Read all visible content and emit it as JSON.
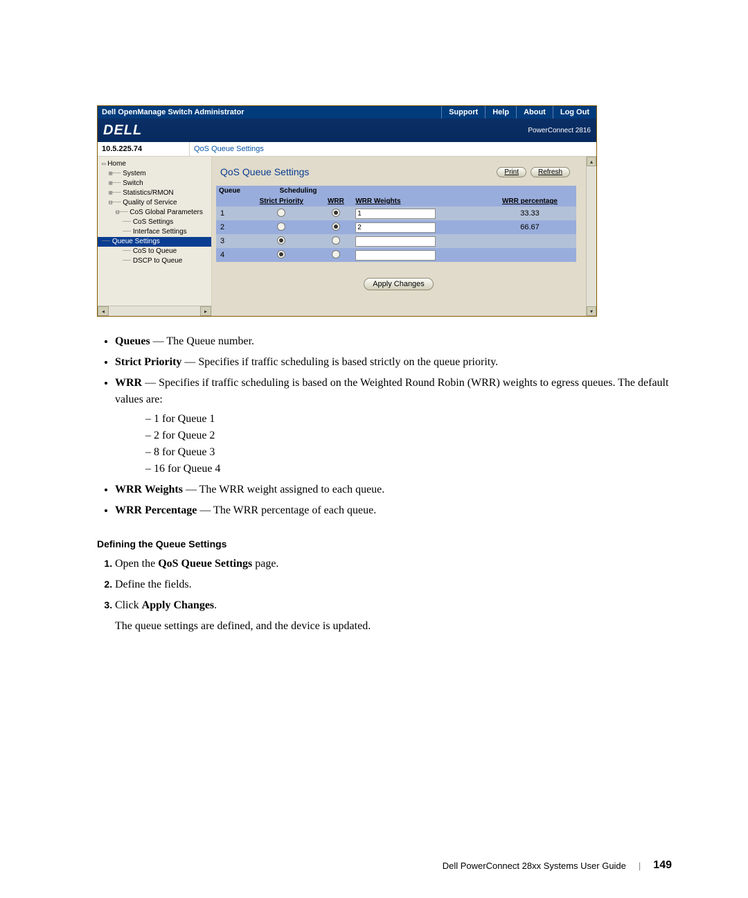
{
  "app": {
    "title": "Dell OpenManage Switch Administrator",
    "menu": {
      "support": "Support",
      "help": "Help",
      "about": "About",
      "logout": "Log Out"
    },
    "brand": "DELL",
    "model": "PowerConnect 2816",
    "ip": "10.5.225.74",
    "breadcrumb": "QoS Queue Settings"
  },
  "nav": {
    "home": "Home",
    "system": "System",
    "switch": "Switch",
    "stats": "Statistics/RMON",
    "qos": "Quality of Service",
    "cos_global": "CoS Global Parameters",
    "cos_settings": "CoS Settings",
    "interface_settings": "Interface Settings",
    "queue_settings": "Queue Settings",
    "cos_to_queue": "CoS to Queue",
    "dscp_to_queue": "DSCP to Queue"
  },
  "main": {
    "title": "QoS Queue Settings",
    "print": "Print",
    "refresh": "Refresh",
    "apply": "Apply Changes",
    "headers": {
      "queue": "Queue",
      "scheduling": "Scheduling",
      "strict": "Strict Priority",
      "wrr": "WRR",
      "weights": "WRR Weights",
      "percentage": "WRR percentage"
    },
    "rows": [
      {
        "queue": "1",
        "sp": false,
        "wrr": true,
        "weight": "1",
        "pct": "33.33"
      },
      {
        "queue": "2",
        "sp": false,
        "wrr": true,
        "weight": "2",
        "pct": "66.67"
      },
      {
        "queue": "3",
        "sp": true,
        "wrr": false,
        "weight": "",
        "pct": ""
      },
      {
        "queue": "4",
        "sp": true,
        "wrr": false,
        "weight": "",
        "pct": ""
      }
    ]
  },
  "doc": {
    "b_queues_term": "Queues",
    "b_queues_desc": " — The Queue number.",
    "b_sp_term": "Strict Priority",
    "b_sp_desc": " — Specifies if traffic scheduling is based strictly on the queue priority.",
    "b_wrr_term": "WRR",
    "b_wrr_desc": " — Specifies if traffic scheduling is based on the Weighted Round Robin (WRR) weights to egress queues. The default values are:",
    "wrr_defaults": [
      "1 for Queue 1",
      "2 for Queue 2",
      "8 for Queue 3",
      "16 for Queue 4"
    ],
    "b_ww_term": "WRR Weights",
    "b_ww_desc": " — The WRR weight assigned to each queue.",
    "b_wp_term": "WRR Percentage",
    "b_wp_desc": " — The WRR percentage of each queue.",
    "heading": "Defining the Queue Settings",
    "step1a": "Open the ",
    "step1b": "QoS Queue Settings",
    "step1c": " page.",
    "step2": "Define the fields.",
    "step3a": "Click ",
    "step3b": "Apply Changes",
    "step3c": ".",
    "result": "The queue settings are defined, and the device is updated."
  },
  "footer": {
    "guide": "Dell PowerConnect 28xx Systems User Guide",
    "page": "149"
  }
}
